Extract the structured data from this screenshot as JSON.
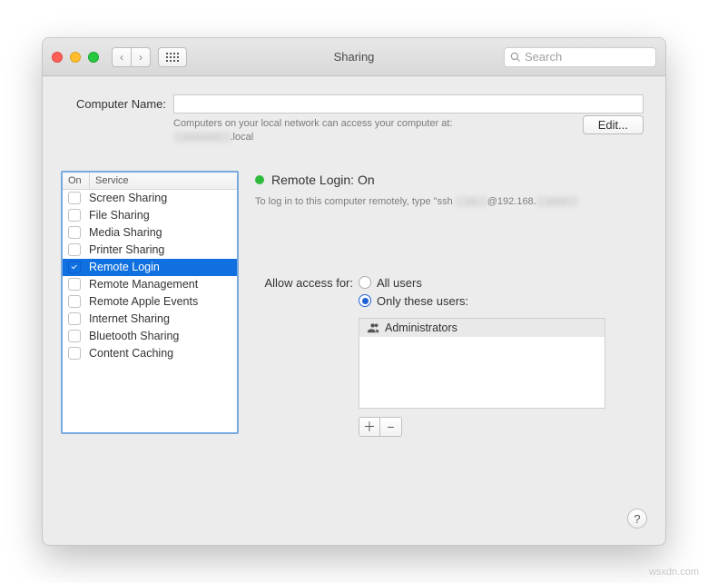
{
  "window": {
    "title": "Sharing"
  },
  "search": {
    "placeholder": "Search"
  },
  "computer_name": {
    "label": "Computer Name:",
    "value": "",
    "hint_line1": "Computers on your local network can access your computer at:",
    "hint_line2_suffix": ".local",
    "edit_label": "Edit..."
  },
  "service_list": {
    "header_on": "On",
    "header_service": "Service",
    "items": [
      {
        "label": "Screen Sharing",
        "on": false,
        "selected": false
      },
      {
        "label": "File Sharing",
        "on": false,
        "selected": false
      },
      {
        "label": "Media Sharing",
        "on": false,
        "selected": false
      },
      {
        "label": "Printer Sharing",
        "on": false,
        "selected": false
      },
      {
        "label": "Remote Login",
        "on": true,
        "selected": true
      },
      {
        "label": "Remote Management",
        "on": false,
        "selected": false
      },
      {
        "label": "Remote Apple Events",
        "on": false,
        "selected": false
      },
      {
        "label": "Internet Sharing",
        "on": false,
        "selected": false
      },
      {
        "label": "Bluetooth Sharing",
        "on": false,
        "selected": false
      },
      {
        "label": "Content Caching",
        "on": false,
        "selected": false
      }
    ]
  },
  "status": {
    "title": "Remote Login: On",
    "hint_prefix": "To log in to this computer remotely, type \"ssh ",
    "hint_suffix": "@192.168."
  },
  "access": {
    "label": "Allow access for:",
    "option_all": "All users",
    "option_only": "Only these users:",
    "selected": "only",
    "users": [
      {
        "label": "Administrators"
      }
    ]
  },
  "watermark": "wsxdn.com"
}
